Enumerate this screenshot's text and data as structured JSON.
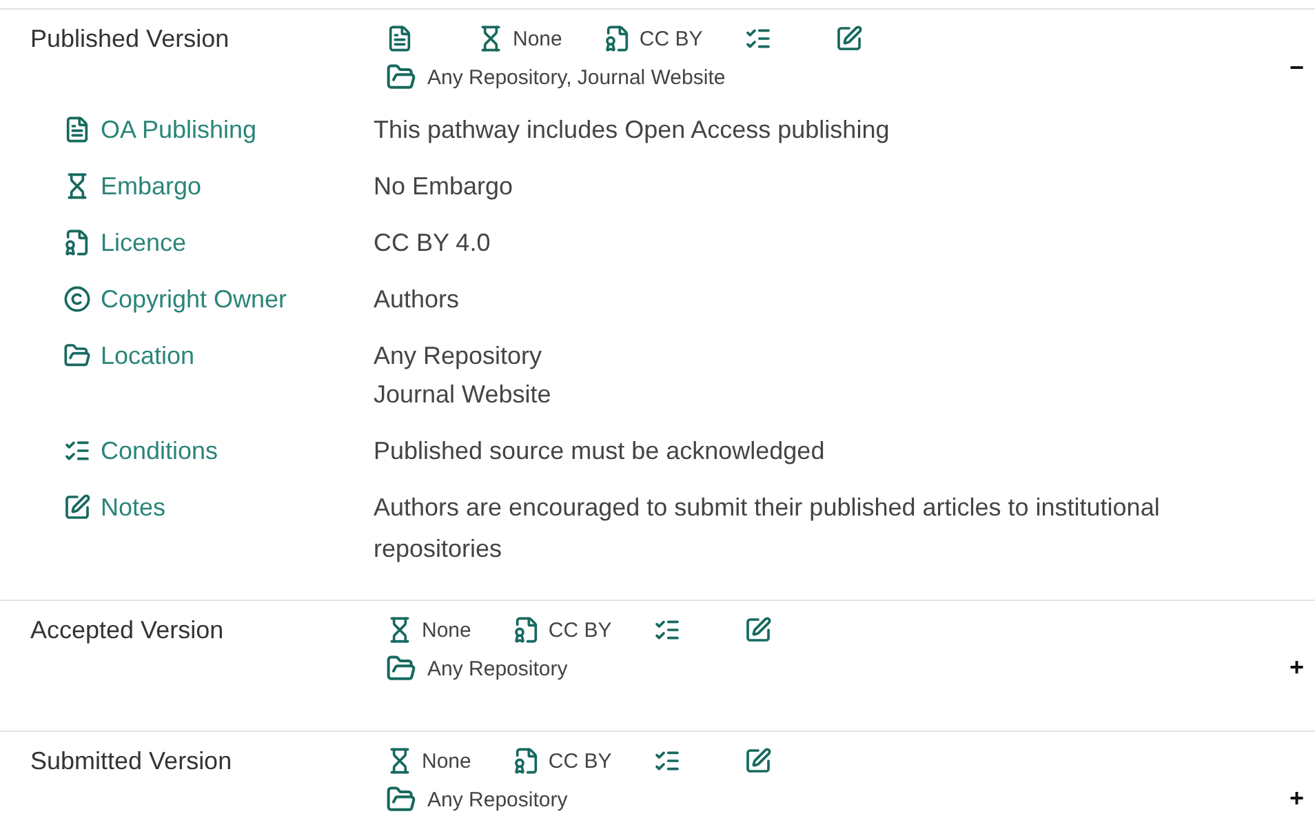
{
  "sections": [
    {
      "title": "Published Version",
      "toggle": "−",
      "badges": [
        {
          "kind": "oa"
        },
        {
          "kind": "embargo",
          "text": "None"
        },
        {
          "kind": "licence",
          "text": "CC BY"
        },
        {
          "kind": "conditions"
        },
        {
          "kind": "notes"
        }
      ],
      "location": "Any Repository, Journal Website",
      "details": [
        {
          "kind": "oa",
          "label": "OA Publishing",
          "values": [
            "This pathway includes Open Access publishing"
          ]
        },
        {
          "kind": "embargo",
          "label": "Embargo",
          "values": [
            "No Embargo"
          ]
        },
        {
          "kind": "licence",
          "label": "Licence",
          "values": [
            "CC BY 4.0"
          ]
        },
        {
          "kind": "copyright",
          "label": "Copyright Owner",
          "values": [
            "Authors"
          ]
        },
        {
          "kind": "location",
          "label": "Location",
          "values": [
            "Any Repository",
            "Journal Website"
          ]
        },
        {
          "kind": "conditions",
          "label": "Conditions",
          "values": [
            "Published source must be acknowledged"
          ]
        },
        {
          "kind": "notes",
          "label": "Notes",
          "values": [
            "Authors are encouraged to submit their published articles to institutional repositories"
          ]
        }
      ]
    },
    {
      "title": "Accepted Version",
      "toggle": "+",
      "badges": [
        {
          "kind": "embargo",
          "text": "None"
        },
        {
          "kind": "licence",
          "text": "CC BY"
        },
        {
          "kind": "conditions"
        },
        {
          "kind": "notes"
        }
      ],
      "location": "Any Repository"
    },
    {
      "title": "Submitted Version",
      "toggle": "+",
      "badges": [
        {
          "kind": "embargo",
          "text": "None"
        },
        {
          "kind": "licence",
          "text": "CC BY"
        },
        {
          "kind": "conditions"
        },
        {
          "kind": "notes"
        }
      ],
      "location": "Any Repository"
    }
  ]
}
